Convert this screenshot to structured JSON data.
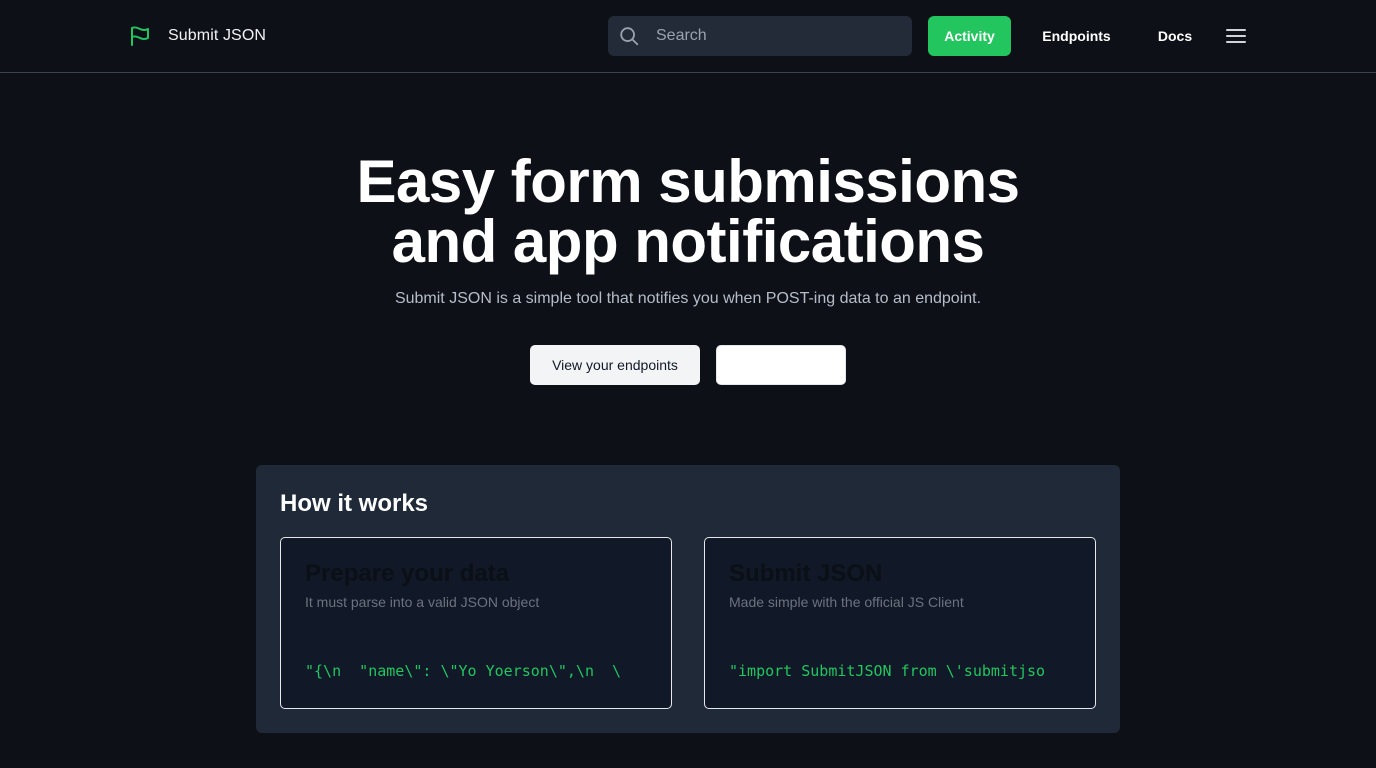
{
  "header": {
    "brand_name": "Submit JSON",
    "brand_icon": "flag-icon",
    "search": {
      "placeholder": "Search",
      "icon": "search-icon",
      "value": ""
    },
    "nav": {
      "activity": "Activity",
      "endpoints": "Endpoints",
      "docs": "Docs"
    },
    "menu_icon": "hamburger-menu-icon"
  },
  "hero": {
    "title_line1": "Easy form submissions",
    "title_line2": "and app notifications",
    "subtitle": "Submit JSON is a simple tool that notifies you when POST-ing data to an endpoint.",
    "primary_button": "View your endpoints",
    "secondary_button": ""
  },
  "how_it_works": {
    "title": "How it works",
    "cards": [
      {
        "title": "Prepare your data",
        "description": "It must parse into a valid JSON object",
        "code": "\"{\\n  \"name\\\": \\\"Yo Yoerson\\\",\\n  \\"
      },
      {
        "title": "Submit JSON",
        "description": "Made simple with the official JS Client",
        "code": "\"import SubmitJSON from \\'submitjso"
      }
    ]
  },
  "colors": {
    "background": "#0d1117",
    "accent": "#22c55e",
    "panel": "#1f2937",
    "card": "#111827"
  }
}
